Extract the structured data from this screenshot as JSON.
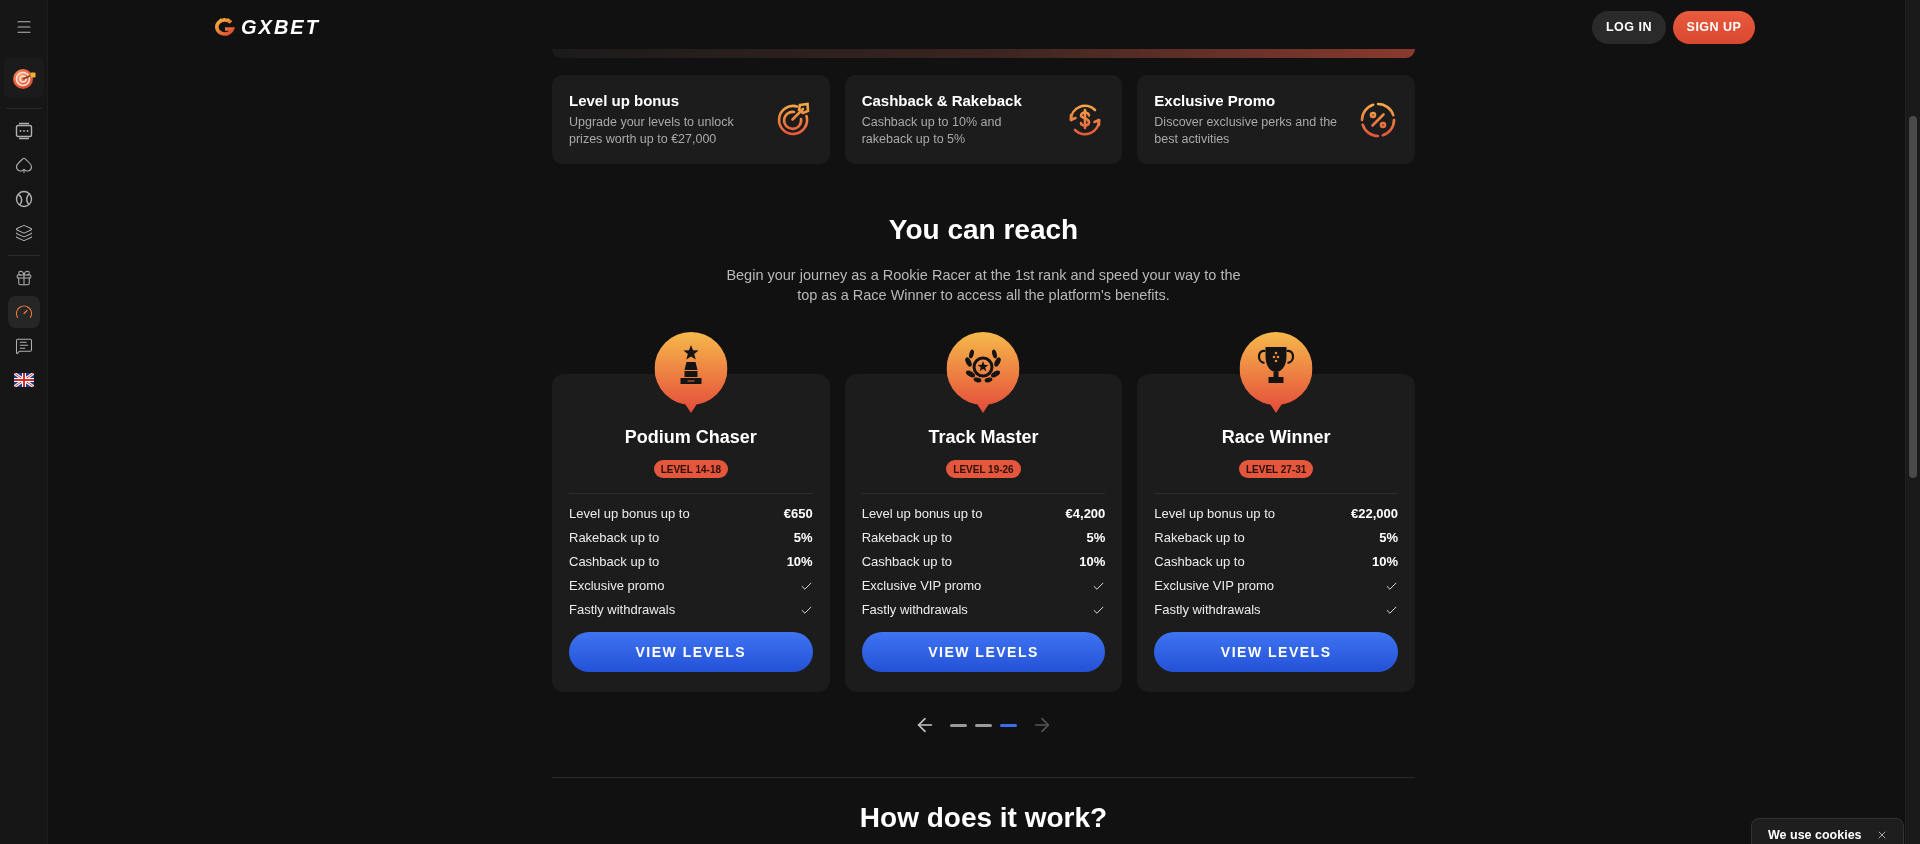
{
  "sidebar": {
    "items": [
      {
        "selected": false
      },
      {
        "selected": false
      },
      {
        "selected": false
      },
      {
        "selected": false
      },
      {
        "selected": false
      },
      {
        "selected": true
      },
      {
        "selected": false
      },
      {
        "selected": false
      }
    ]
  },
  "header": {
    "logo": "GXBET",
    "login": "LOG IN",
    "signup": "SIGN UP"
  },
  "features": [
    {
      "title": "Level up bonus",
      "description": "Upgrade your levels to unlock prizes worth up to €27,000"
    },
    {
      "title": "Cashback & Rakeback",
      "description": "Cashback up to 10% and rakeback up to 5%"
    },
    {
      "title": "Exclusive Promo",
      "description": "Discover exclusive perks and the best activities"
    }
  ],
  "reach": {
    "title": "You can reach",
    "description": "Begin your journey as a Rookie Racer at the 1st rank and speed your way to the top as a Race Winner to access all the platform's benefits.",
    "tiers": [
      {
        "name": "Podium Chaser",
        "level": "LEVEL 14-18",
        "rows": [
          {
            "kind": "value",
            "label": "Level up bonus up to",
            "value": "€650"
          },
          {
            "kind": "value",
            "label": "Rakeback up to",
            "value": "5%"
          },
          {
            "kind": "value",
            "label": "Cashback up to",
            "value": "10%"
          },
          {
            "kind": "check",
            "label": "Exclusive promo"
          },
          {
            "kind": "check",
            "label": "Fastly withdrawals"
          }
        ],
        "button": "VIEW LEVELS"
      },
      {
        "name": "Track Master",
        "level": "LEVEL 19-26",
        "rows": [
          {
            "kind": "value",
            "label": "Level up bonus up to",
            "value": "€4,200"
          },
          {
            "kind": "value",
            "label": "Rakeback up to",
            "value": "5%"
          },
          {
            "kind": "value",
            "label": "Cashback up to",
            "value": "10%"
          },
          {
            "kind": "check",
            "label": "Exclusive VIP promo"
          },
          {
            "kind": "check",
            "label": "Fastly withdrawals"
          }
        ],
        "button": "VIEW LEVELS"
      },
      {
        "name": "Race Winner",
        "level": "LEVEL 27-31",
        "rows": [
          {
            "kind": "value",
            "label": "Level up bonus up to",
            "value": "€22,000"
          },
          {
            "kind": "value",
            "label": "Rakeback up to",
            "value": "5%"
          },
          {
            "kind": "value",
            "label": "Cashback up to",
            "value": "10%"
          },
          {
            "kind": "check",
            "label": "Exclusive VIP promo"
          },
          {
            "kind": "check",
            "label": "Fastly withdrawals"
          }
        ],
        "button": "VIEW LEVELS"
      }
    ],
    "carousel": {
      "prev": {
        "disabled": false
      },
      "next": {
        "disabled": true
      },
      "pages": [
        {
          "selected": false
        },
        {
          "selected": false
        },
        {
          "selected": true
        }
      ]
    }
  },
  "next_section": {
    "title": "How does it work?"
  },
  "cookie_notice": {
    "text": "We use cookies"
  }
}
